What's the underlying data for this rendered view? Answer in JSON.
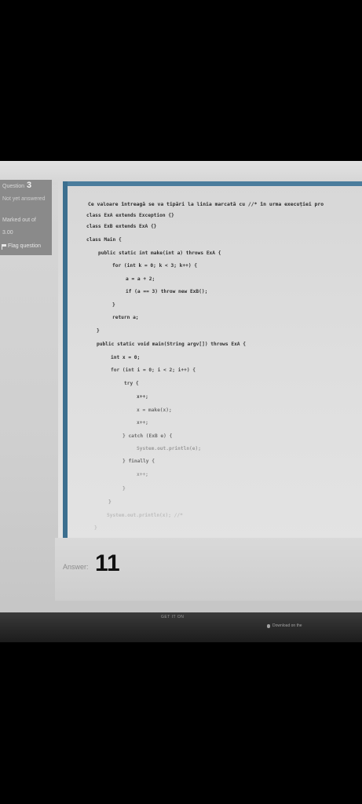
{
  "question_info": {
    "question_prefix": "Question",
    "question_number": "3",
    "status": "Not yet answered",
    "marked_label": "Marked out of",
    "points": "3.00",
    "flag_label": "Flag question"
  },
  "question_text": "Ce valoare întreagă se va tipări la linia marcată cu //* în urma execuției pro",
  "code_lines": [
    "class ExA extends Exception {}",
    "class ExB extends ExA {}",
    "class Main {",
    "public static int make(int a) throws ExA {",
    "for (int k = 0; k < 3; k++) {",
    "a = a + 2;",
    "if (a == 3) throw new ExB();",
    "}",
    "return a;",
    "}",
    "public static void main(String argv[]) throws ExA {",
    "int x = 0;",
    "for (int i = 0; i < 2; i++) {",
    "try {",
    "x++;",
    "x = make(x);",
    "x++;",
    "} catch (ExB e) {",
    "System.out.println(e);",
    "} finally {",
    "x++;",
    "}",
    "}",
    "System.out.println(x); //*",
    "}"
  ],
  "answer": {
    "label": "Answer:",
    "value": "11"
  },
  "footer": {
    "store_left": "GET IT ON",
    "store_right": "Download on the"
  }
}
